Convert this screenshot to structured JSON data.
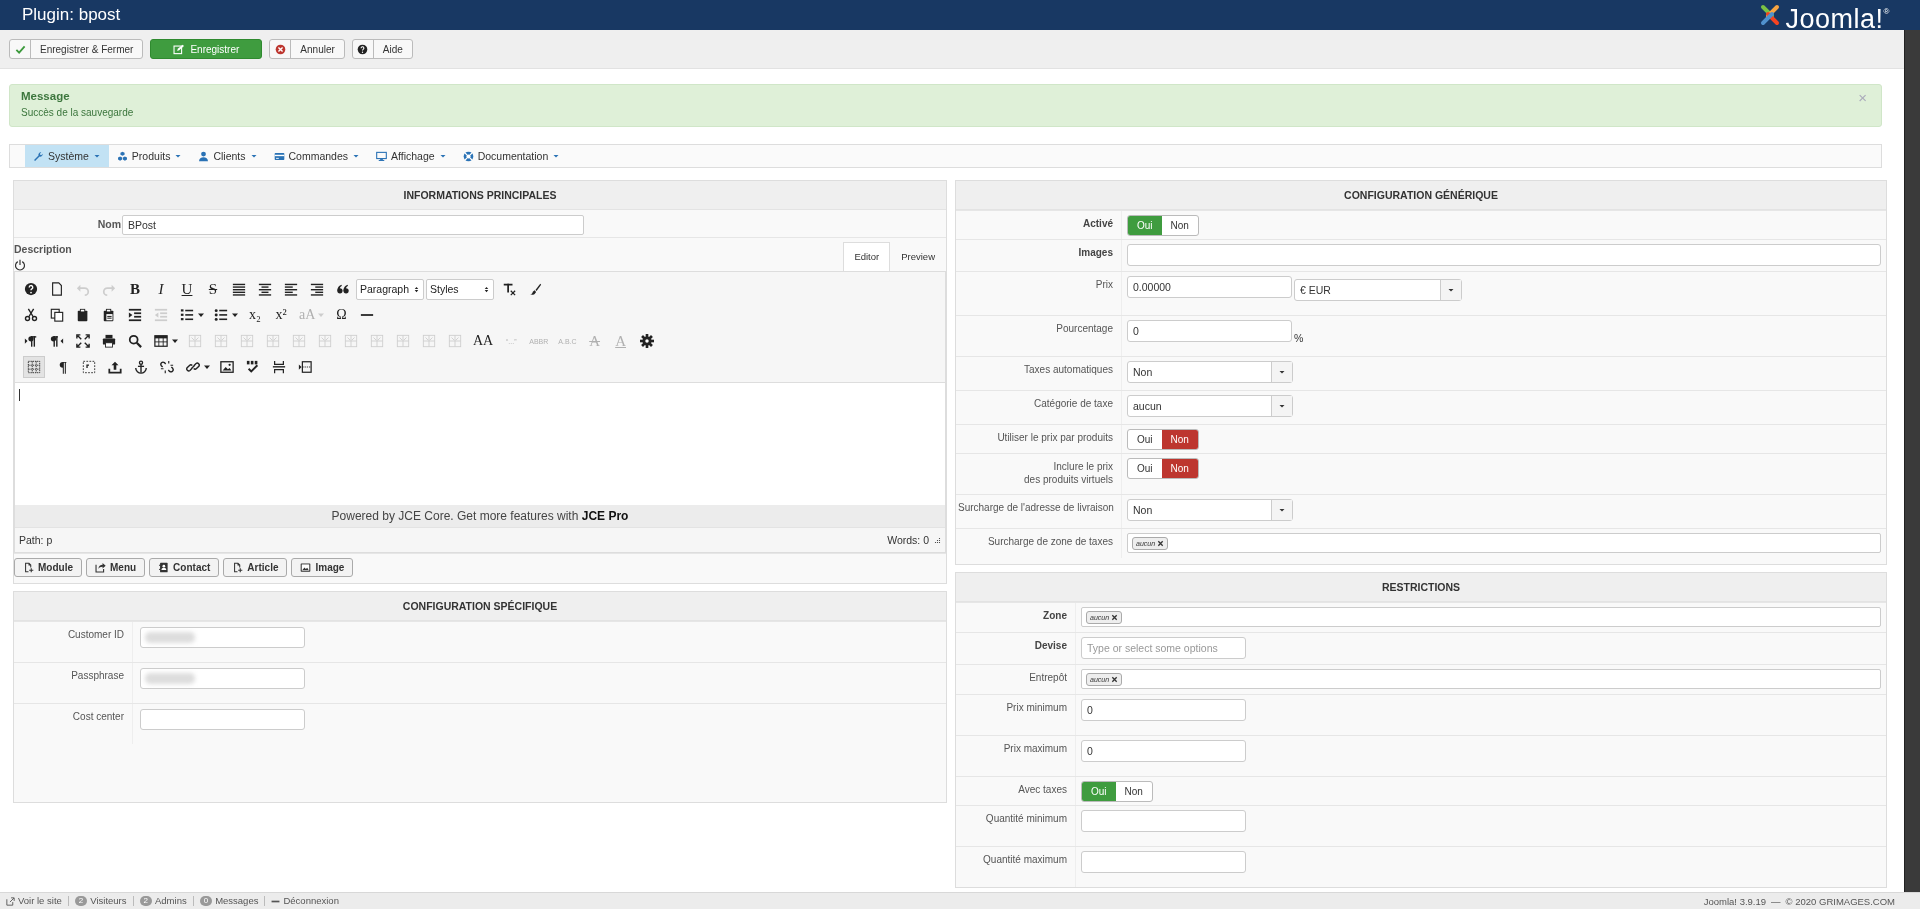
{
  "window": {
    "title": "Plugin: bpost",
    "logo": "Joomla!$^{®}$"
  },
  "toolbar": [
    {
      "label": "Enregistrer & Fermer",
      "primary": false
    },
    {
      "label": "Enregistrer",
      "primary": true
    },
    {
      "label": "Annuler",
      "primary": false
    },
    {
      "label": "Aide",
      "primary": false
    }
  ],
  "message": {
    "title": "Message",
    "text": "Succès de la sauvegarde",
    "close": "×"
  },
  "menu": [
    {
      "label": "Système",
      "selected": true
    },
    {
      "label": "Produits",
      "selected": false
    },
    {
      "label": "Clients",
      "selected": false
    },
    {
      "label": "Commandes",
      "selected": false
    },
    {
      "label": "Affichage",
      "selected": false
    },
    {
      "label": "Documentation",
      "selected": false
    }
  ],
  "main_info": {
    "title": "INFORMATIONS PRINCIPALES",
    "name_label": "Nom",
    "name_value": "BPost",
    "description_label": "Description",
    "tabs": [
      {
        "label": "Editor",
        "selected": true
      },
      {
        "label": "Preview",
        "selected": false
      }
    ],
    "toolbar_rows": [
      [
        {
          "kind": "icon",
          "disabled": false,
          "active": false
        },
        {
          "kind": "icon",
          "disabled": false,
          "active": false
        },
        {
          "kind": "icon",
          "disabled": true,
          "active": false
        },
        {
          "kind": "icon",
          "disabled": true,
          "active": false
        },
        {
          "kind": "bold",
          "text": "B",
          "disabled": false,
          "active": false
        },
        {
          "kind": "italic",
          "text": "I",
          "disabled": false,
          "active": false
        },
        {
          "kind": "underline",
          "text": "U",
          "disabled": false,
          "active": false
        },
        {
          "kind": "strike",
          "text": "S",
          "disabled": false,
          "active": false
        },
        {
          "kind": "icon",
          "disabled": false,
          "active": false
        },
        {
          "kind": "icon",
          "disabled": false,
          "active": false
        },
        {
          "kind": "icon",
          "disabled": false,
          "active": false
        },
        {
          "kind": "icon",
          "disabled": false,
          "active": false
        },
        {
          "kind": "icon",
          "disabled": false,
          "active": false
        },
        {
          "kind": "select",
          "text": "Paragraph",
          "disabled": false,
          "active": false
        },
        {
          "kind": "select",
          "text": "Styles",
          "disabled": false,
          "active": false
        },
        {
          "kind": "icon",
          "disabled": false,
          "active": false
        },
        {
          "kind": "icon",
          "disabled": false,
          "active": false
        }
      ],
      [
        {
          "kind": "icon",
          "disabled": false,
          "active": false
        },
        {
          "kind": "icon",
          "disabled": false,
          "active": false
        },
        {
          "kind": "icon",
          "disabled": false,
          "active": false
        },
        {
          "kind": "icon",
          "disabled": false,
          "active": false
        },
        {
          "kind": "icon",
          "disabled": false,
          "active": false
        },
        {
          "kind": "icon",
          "disabled": true,
          "active": false
        },
        {
          "kind": "icon",
          "disabled": false,
          "active": false
        },
        {
          "kind": "caret",
          "disabled": false,
          "active": false
        },
        {
          "kind": "icon",
          "disabled": false,
          "active": false
        },
        {
          "kind": "caret",
          "disabled": false,
          "active": false
        },
        {
          "kind": "glyph",
          "text": "x₂",
          "disabled": false,
          "active": false
        },
        {
          "kind": "glyph",
          "text": "x²",
          "disabled": false,
          "active": false
        },
        {
          "kind": "glyph",
          "text": "aA",
          "disabled": true,
          "active": false
        },
        {
          "kind": "caret",
          "disabled": true,
          "active": false
        },
        {
          "kind": "glyph",
          "text": "Ω",
          "disabled": false,
          "active": false
        },
        {
          "kind": "icon",
          "disabled": false,
          "active": false
        }
      ],
      [
        {
          "kind": "icon",
          "disabled": false,
          "active": false
        },
        {
          "kind": "icon",
          "disabled": false,
          "active": false
        },
        {
          "kind": "icon",
          "disabled": false,
          "active": false
        },
        {
          "kind": "icon",
          "disabled": false,
          "active": false
        },
        {
          "kind": "icon",
          "disabled": false,
          "active": false
        },
        {
          "kind": "icon",
          "disabled": false,
          "active": false
        },
        {
          "kind": "caret",
          "disabled": false,
          "active": false
        },
        {
          "kind": "icon",
          "disabled": true,
          "active": false
        },
        {
          "kind": "icon",
          "disabled": true,
          "active": false
        },
        {
          "kind": "icon",
          "disabled": true,
          "active": false
        },
        {
          "kind": "icon",
          "disabled": true,
          "active": false
        },
        {
          "kind": "icon",
          "disabled": true,
          "active": false
        },
        {
          "kind": "icon",
          "disabled": true,
          "active": false
        },
        {
          "kind": "icon",
          "disabled": true,
          "active": false
        },
        {
          "kind": "icon",
          "disabled": true,
          "active": false
        },
        {
          "kind": "icon",
          "disabled": true,
          "active": false
        },
        {
          "kind": "icon",
          "disabled": true,
          "active": false
        },
        {
          "kind": "icon",
          "disabled": true,
          "active": false
        },
        {
          "kind": "glyph",
          "text": "AA",
          "disabled": false,
          "active": false
        },
        {
          "kind": "small",
          "text": "“...”",
          "disabled": true,
          "active": false
        },
        {
          "kind": "small",
          "text": "ABBR",
          "disabled": true,
          "active": false
        },
        {
          "kind": "small",
          "text": "A.B.C",
          "disabled": true,
          "active": false
        },
        {
          "kind": "strike",
          "text": "A",
          "disabled": true,
          "active": false
        },
        {
          "kind": "underline",
          "text": "A",
          "disabled": true,
          "active": false
        },
        {
          "kind": "icon",
          "disabled": false,
          "active": false
        }
      ],
      [
        {
          "kind": "icon",
          "disabled": false,
          "active": true
        },
        {
          "kind": "bold",
          "text": "¶",
          "disabled": false,
          "active": false
        },
        {
          "kind": "icon",
          "disabled": false,
          "active": false
        },
        {
          "kind": "icon",
          "disabled": false,
          "active": false
        },
        {
          "kind": "icon",
          "disabled": false,
          "active": false
        },
        {
          "kind": "icon",
          "disabled": false,
          "active": false
        },
        {
          "kind": "icon",
          "disabled": false,
          "active": false
        },
        {
          "kind": "caret",
          "disabled": false,
          "active": false
        },
        {
          "kind": "icon",
          "disabled": false,
          "active": false
        },
        {
          "kind": "icon",
          "disabled": false,
          "active": false
        },
        {
          "kind": "icon",
          "disabled": false,
          "active": false
        },
        {
          "kind": "icon",
          "disabled": false,
          "active": false
        }
      ]
    ],
    "status": "Powered by JCE Core. Get more features with **JCE Pro**",
    "path": "Path: p",
    "words": "Words: 0",
    "buttons": [
      "Module",
      "Menu",
      "Contact",
      "Article",
      "Image"
    ]
  },
  "specific": {
    "title": "CONFIGURATION SPÉCIFIQUE",
    "rows": [
      {
        "label": "Customer ID",
        "blurred": true
      },
      {
        "label": "Passphrase",
        "blurred": true
      },
      {
        "label": "Cost center",
        "blurred": false
      }
    ]
  },
  "generic": {
    "title": "CONFIGURATION GÉNÉRIQUE",
    "rows": [
      {
        "kind": "toggle",
        "label": "Activé",
        "bold": true,
        "options": [
          {
            "label": "Oui",
            "selected": true
          },
          {
            "label": "Non",
            "selected": false
          }
        ]
      },
      {
        "kind": "wide_input",
        "label": "Images",
        "bold": true
      },
      {
        "kind": "price",
        "label": "Prix",
        "bold": false,
        "value": "0.00000",
        "currency": "€ EUR"
      },
      {
        "kind": "percent",
        "label": "Pourcentage",
        "bold": false,
        "value": "0",
        "unit": "%"
      },
      {
        "kind": "select",
        "label": "Taxes automatiques",
        "bold": false,
        "value": "Non"
      },
      {
        "kind": "select",
        "label": "Catégorie de taxe",
        "bold": false,
        "value": "aucun"
      },
      {
        "kind": "toggle",
        "label": "Utiliser le prix par produits",
        "bold": false,
        "options": [
          {
            "label": "Oui",
            "selected": false
          },
          {
            "label": "Non",
            "selected": true
          }
        ]
      },
      {
        "kind": "toggle",
        "label": "Inclure le prix\ndes produits virtuels",
        "bold": false,
        "options": [
          {
            "label": "Oui",
            "selected": false
          },
          {
            "label": "Non",
            "selected": true
          }
        ]
      },
      {
        "kind": "select",
        "label": "Surcharge de l'adresse de livraison",
        "bold": false,
        "value": "Non"
      },
      {
        "kind": "tags",
        "label": "Surcharge de zone de taxes",
        "bold": false,
        "tags": [
          "aucun"
        ]
      }
    ]
  },
  "restrictions": {
    "title": "RESTRICTIONS",
    "rows": [
      {
        "kind": "tags",
        "label": "Zone",
        "bold": true,
        "tags": [
          "aucun"
        ]
      },
      {
        "kind": "placeholder",
        "label": "Devise",
        "bold": true,
        "placeholder": "Type or select some options"
      },
      {
        "kind": "tags",
        "label": "Entrepôt",
        "bold": false,
        "tags": [
          "aucun"
        ]
      },
      {
        "kind": "input",
        "label": "Prix minimum",
        "bold": false,
        "value": "0"
      },
      {
        "kind": "input",
        "label": "Prix maximum",
        "bold": false,
        "value": "0"
      },
      {
        "kind": "toggle",
        "label": "Avec taxes",
        "bold": false,
        "options": [
          {
            "label": "Oui",
            "selected": true
          },
          {
            "label": "Non",
            "selected": false
          }
        ]
      },
      {
        "kind": "input",
        "label": "Quantité minimum",
        "bold": false
      },
      {
        "kind": "input",
        "label": "Quantité maximum",
        "bold": false
      }
    ]
  },
  "status_bar": {
    "items": [
      {
        "kind": "link",
        "label": "Voir le site"
      },
      {
        "kind": "count",
        "count": "2",
        "label": "Visiteurs"
      },
      {
        "kind": "count",
        "count": "2",
        "label": "Admins"
      },
      {
        "kind": "count",
        "count": "0",
        "label": "Messages"
      },
      {
        "kind": "logout",
        "label": "Déconnexion"
      }
    ],
    "version": "Joomla! 3.9.19",
    "separator": "—",
    "copyright": "© 2020 GRIMAGES.COM"
  }
}
